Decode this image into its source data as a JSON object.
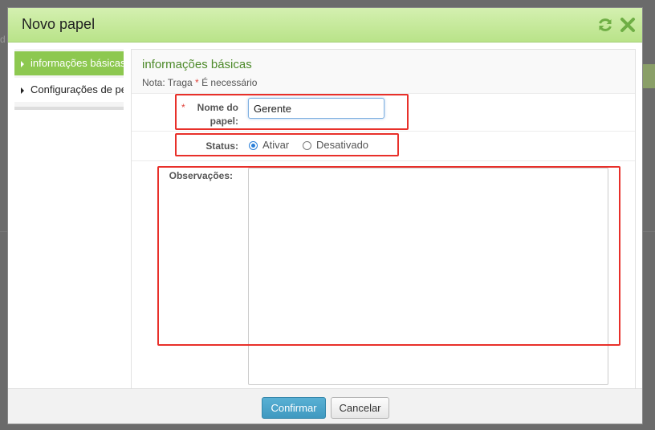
{
  "dialog": {
    "title": "Novo papel"
  },
  "header_icons": {
    "refresh": "refresh-icon",
    "close": "close-icon"
  },
  "sidebar": {
    "items": [
      {
        "label": "informações básicas",
        "active": true
      },
      {
        "label": "Configurações de pe",
        "active": false
      }
    ]
  },
  "panel": {
    "title": "informações básicas",
    "note_prefix": "Nota: Traga",
    "note_star": "*",
    "note_suffix": "É necessário"
  },
  "form": {
    "name_label": "Nome do papel:",
    "name_required": "*",
    "name_value": "Gerente",
    "status_label": "Status:",
    "status_options": [
      "Ativar",
      "Desativado"
    ],
    "status_selected": "Ativar",
    "notes_label": "Observações:",
    "notes_value": ""
  },
  "footer": {
    "confirm_label": "Confirmar",
    "cancel_label": "Cancelar"
  },
  "colors": {
    "header_green": "#b9e389",
    "sidebar_active": "#8dc850",
    "title_green": "#4d8a2a",
    "required": "#e0443c",
    "confirm_blue": "#3f99c0",
    "annotation_red": "#e8302a"
  }
}
